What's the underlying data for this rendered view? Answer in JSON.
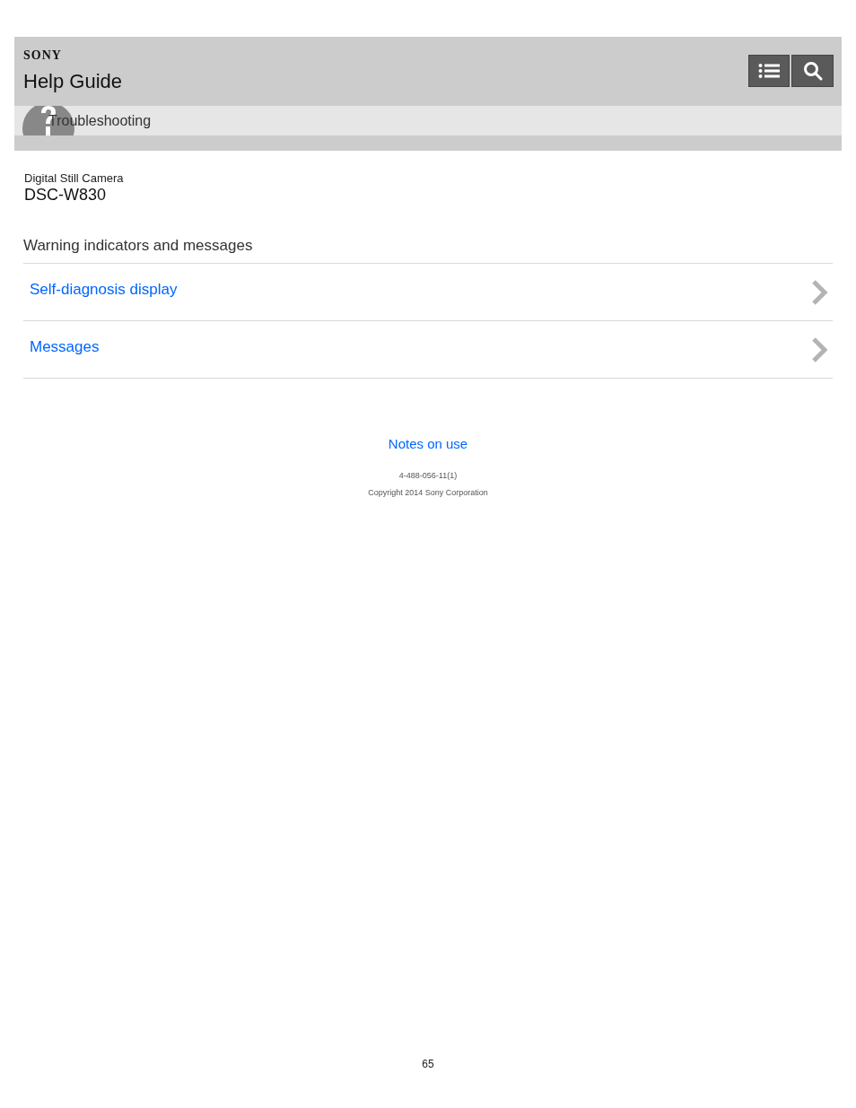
{
  "header": {
    "brand": "SONY",
    "title": "Help Guide",
    "section": "Troubleshooting"
  },
  "product": {
    "category": "Digital Still Camera",
    "model": "DSC-W830"
  },
  "topic": {
    "title": "Warning indicators and messages",
    "links": [
      "Self-diagnosis display",
      "Messages"
    ]
  },
  "footer": {
    "link": "Notes on use",
    "code": "4-488-056-11(1)",
    "copyright": "Copyright 2014 Sony Corporation"
  },
  "page_number": "65"
}
